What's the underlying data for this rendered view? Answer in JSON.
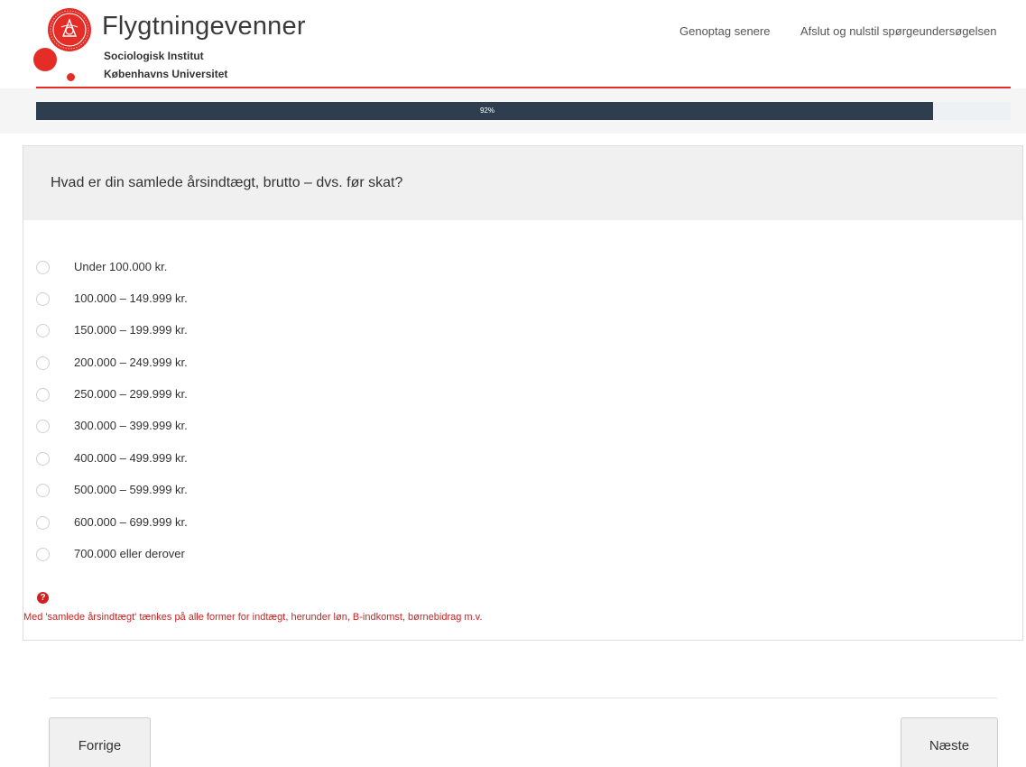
{
  "header": {
    "title": "Flygtningevenner",
    "subtitle_line1": "Sociologisk Institut",
    "subtitle_line2": "Københavns Universitet",
    "resume_later": "Genoptag senere",
    "quit_reset": "Afslut og nulstil spørgeundersøgelsen",
    "accent_color": "#e52d27"
  },
  "progress": {
    "value_percent": 92,
    "label": "92%",
    "color": "#2f3e4e"
  },
  "question": {
    "text": "Hvad er din samlede årsindtægt, brutto – dvs. før skat?",
    "options": [
      "Under 100.000 kr.",
      "100.000 – 149.999 kr.",
      "150.000 – 199.999 kr.",
      "200.000 – 249.999 kr.",
      "250.000 – 299.999 kr.",
      "300.000 – 399.999 kr.",
      "400.000 – 499.999 kr.",
      "500.000 – 599.999 kr.",
      "600.000 – 699.999 kr.",
      "700.000 eller derover"
    ],
    "help_icon": "question-circle-icon",
    "help_text": "Med 'samlede årsindtægt' tænkes på alle former for indtægt, herunder løn, B-indkomst, børnebidrag m.v."
  },
  "navigation": {
    "previous": "Forrige",
    "next": "Næste"
  }
}
